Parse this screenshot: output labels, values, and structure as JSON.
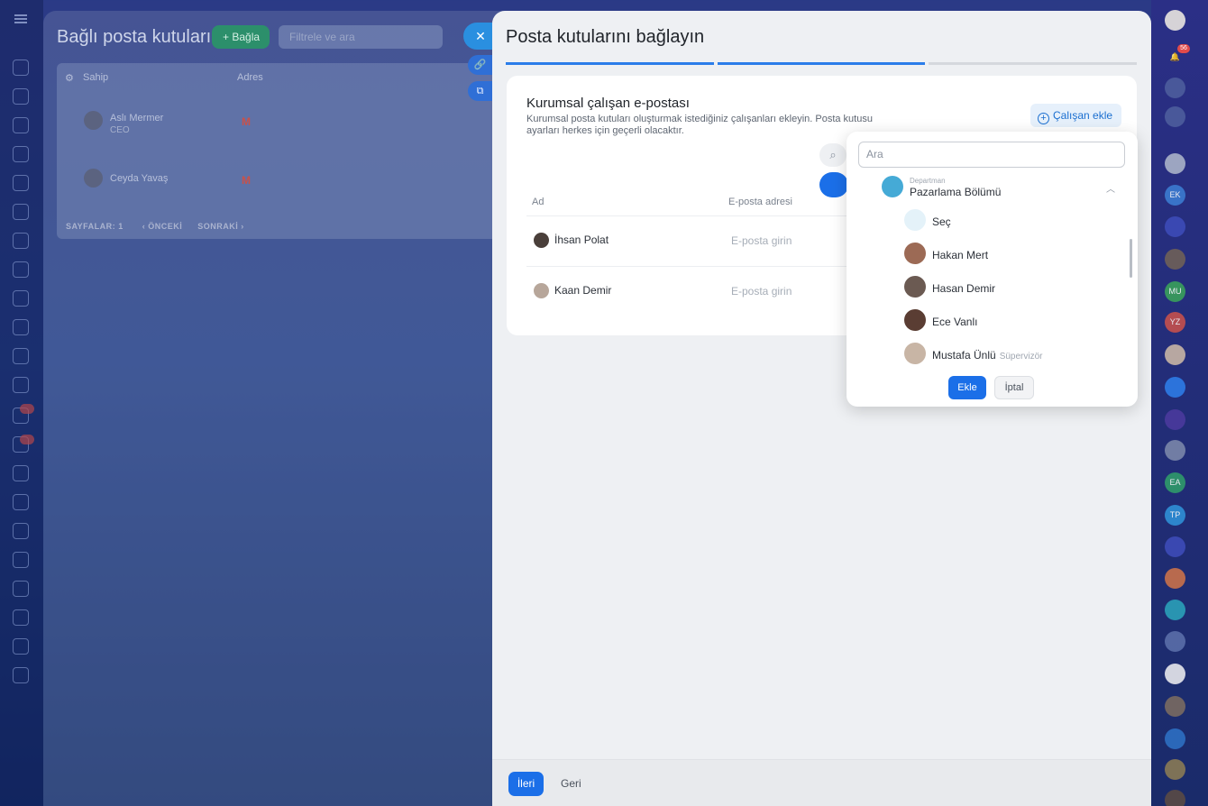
{
  "back": {
    "title": "Bağlı posta kutuları",
    "connect_label": "+ Bağla",
    "filter_placeholder": "Filtrele ve ara",
    "col_owner": "Sahip",
    "col_address": "Adres",
    "rows": [
      {
        "name": "Aslı Mermer",
        "sub": "CEO"
      },
      {
        "name": "Ceyda Yavaş",
        "sub": ""
      }
    ],
    "pager": {
      "pages_label": "SAYFALAR:",
      "page": "1",
      "prev": "ÖNCEKİ",
      "next": "SONRAKİ"
    }
  },
  "main": {
    "title": "Posta kutularını bağlayın",
    "steps": [
      true,
      true,
      false
    ],
    "card": {
      "title": "Kurumsal çalışan e-postası",
      "description": "Kurumsal posta kutuları oluşturmak istediğiniz çalışanları ekleyin. Posta kutusu ayarları herkes için geçerli olacaktır.",
      "add_employee": "Çalışan ekle",
      "col_name": "Ad",
      "col_email": "E-posta adresi",
      "rows": [
        {
          "name": "İhsan Polat",
          "email_placeholder": "E-posta girin"
        },
        {
          "name": "Kaan Demir",
          "email_placeholder": "E-posta girin"
        }
      ]
    }
  },
  "popup": {
    "search_placeholder": "Ara",
    "dept_caption": "Departman",
    "dept_name": "Pazarlama Bölümü",
    "select_all": "Seç",
    "people": [
      {
        "name": "Hakan Mert",
        "role": ""
      },
      {
        "name": "Hasan Demir",
        "role": ""
      },
      {
        "name": "Ece Vanlı",
        "role": ""
      },
      {
        "name": "Mustafa Ünlü",
        "role": "Süpervizör"
      }
    ],
    "add_label": "Ekle",
    "cancel_label": "İptal"
  },
  "footer": {
    "next_label": "İleri",
    "back_label": "Geri"
  },
  "rail": {
    "notif_count": "56",
    "initials": [
      "EK",
      "MU",
      "YZ",
      "EA",
      "TP"
    ]
  }
}
